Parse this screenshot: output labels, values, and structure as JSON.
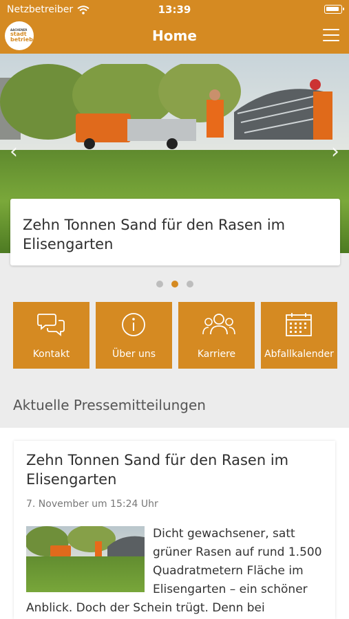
{
  "status": {
    "carrier": "Netzbetreiber",
    "time": "13:39"
  },
  "header": {
    "logo_line1": "AACHENER",
    "logo_line2a": "stadt",
    "logo_line2b": "betrieb",
    "title": "Home"
  },
  "hero": {
    "headline": "Zehn Tonnen Sand für den Rasen im Elisengarten",
    "dots": 3,
    "active_dot": 2
  },
  "tiles": [
    {
      "label": "Kontakt",
      "icon": "chat-bubbles-icon"
    },
    {
      "label": "Über uns",
      "icon": "info-icon"
    },
    {
      "label": "Karriere",
      "icon": "people-icon"
    },
    {
      "label": "Abfallkalender",
      "icon": "calendar-icon"
    }
  ],
  "section": {
    "title": "Aktuelle Pressemitteilungen"
  },
  "article": {
    "title": "Zehn Tonnen Sand für den Rasen im Elisengarten",
    "date": "7. November um 15:24 Uhr",
    "text": "Dicht gewachsener, satt grüner Rasen auf rund 1.500 Quadratmetern Fläche im Elisengarten – ein schöner Anblick. Doch der Schein trügt. Denn bei"
  },
  "colors": {
    "brand": "#d58a22",
    "background": "#ececec",
    "text": "#2f2f2f"
  }
}
